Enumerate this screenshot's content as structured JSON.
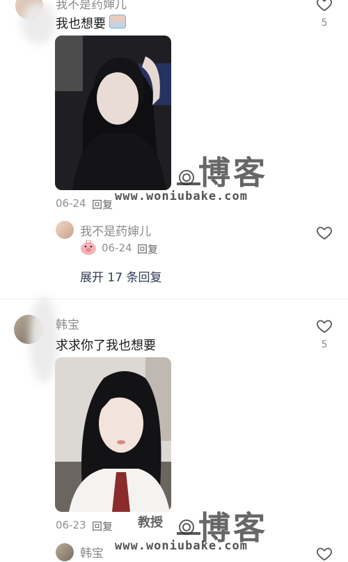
{
  "comments": [
    {
      "name": "我不是药婶儿",
      "text": "我也想要",
      "likes": "5",
      "date": "06-24",
      "reply_label": "回复",
      "reply": {
        "name": "我不是药婶儿",
        "date": "06-24",
        "reply_label": "回复"
      },
      "expand_label": "展开 17 条回复"
    },
    {
      "name": "韩宝",
      "text": "求求你了我也想要",
      "likes": "5",
      "date": "06-23",
      "reply_label": "回复",
      "reply": {
        "name": "韩宝"
      }
    }
  ],
  "watermark": {
    "title": "博客",
    "url": "www.woniubake.com",
    "tag": "教授"
  },
  "colors": {
    "background": "#ffffff",
    "name_gray": "#8a8a8a",
    "expand_blue": "#2f3b55"
  }
}
